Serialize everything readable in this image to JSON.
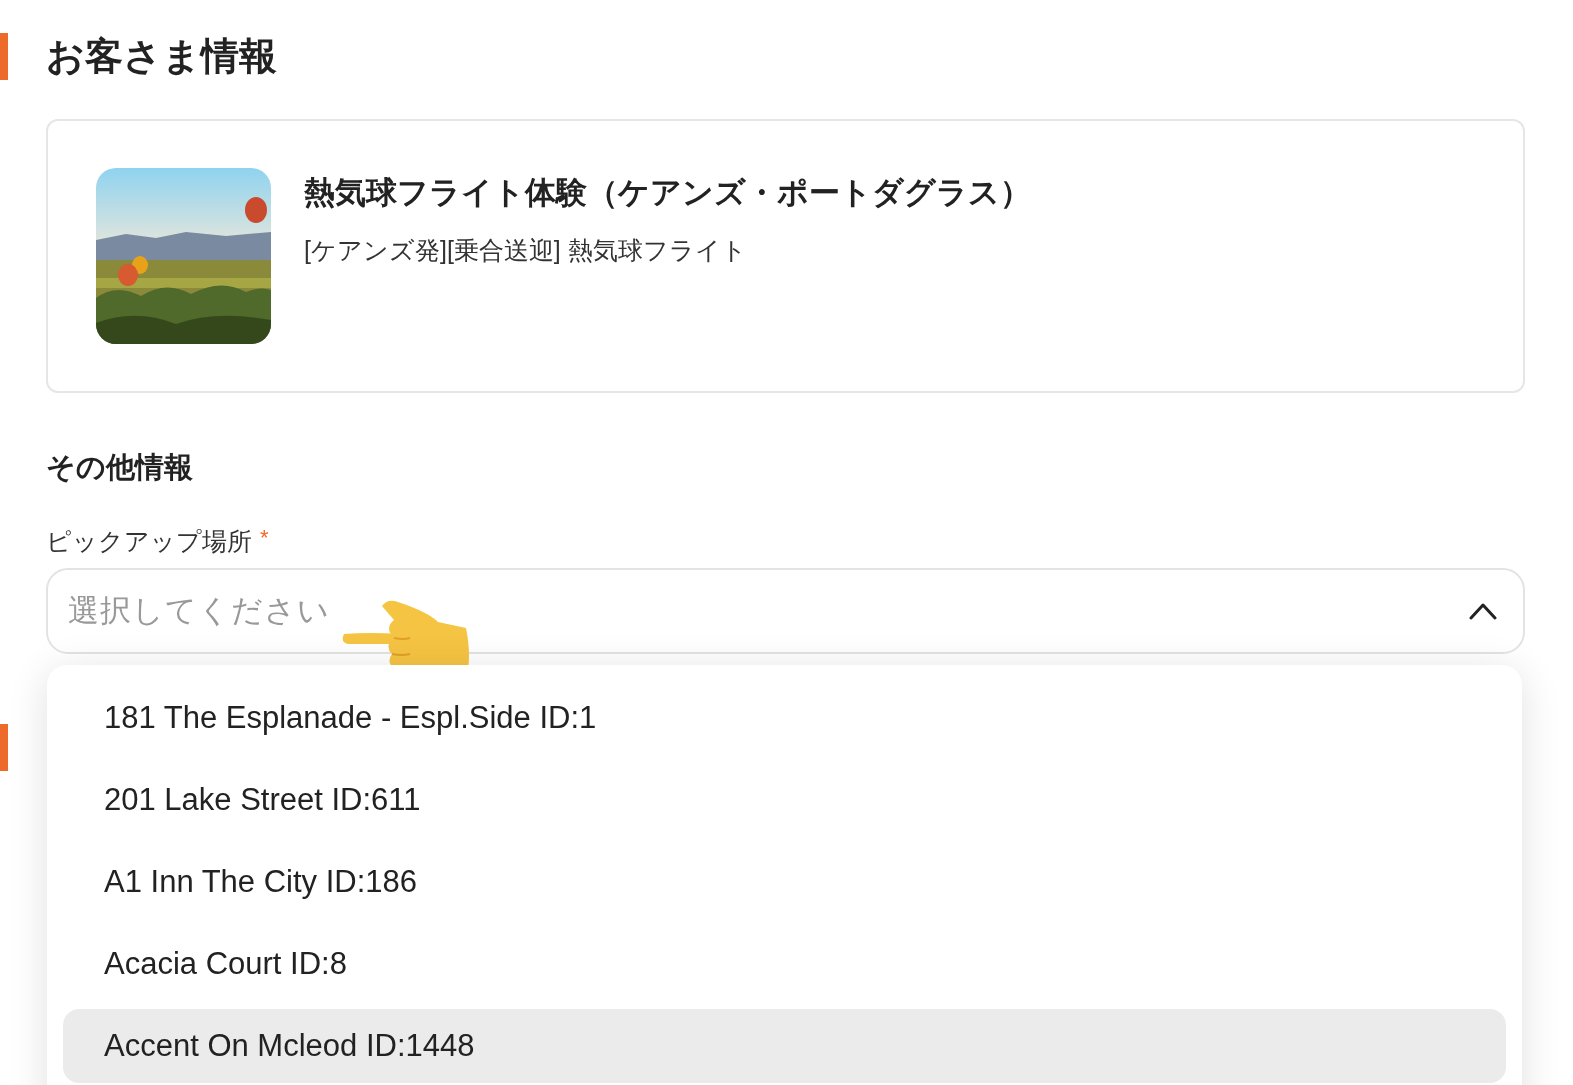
{
  "section_title": "お客さま情報",
  "product": {
    "title": "熱気球フライト体験（ケアンズ・ポートダグラス）",
    "subtitle": "[ケアンズ発][乗合送迎] 熱気球フライト"
  },
  "other_info": {
    "title": "その他情報",
    "field": {
      "label": "ピックアップ場所",
      "required_mark": "*",
      "placeholder": "選択してください",
      "expanded": true
    },
    "options": [
      {
        "label": "181 The Esplanade - Espl.Side ID:1",
        "highlighted": false
      },
      {
        "label": "201 Lake Street ID:611",
        "highlighted": false
      },
      {
        "label": "A1 Inn The City ID:186",
        "highlighted": false
      },
      {
        "label": "Acacia Court ID:8",
        "highlighted": false
      },
      {
        "label": "Accent On Mcleod ID:1448",
        "highlighted": true
      }
    ]
  }
}
